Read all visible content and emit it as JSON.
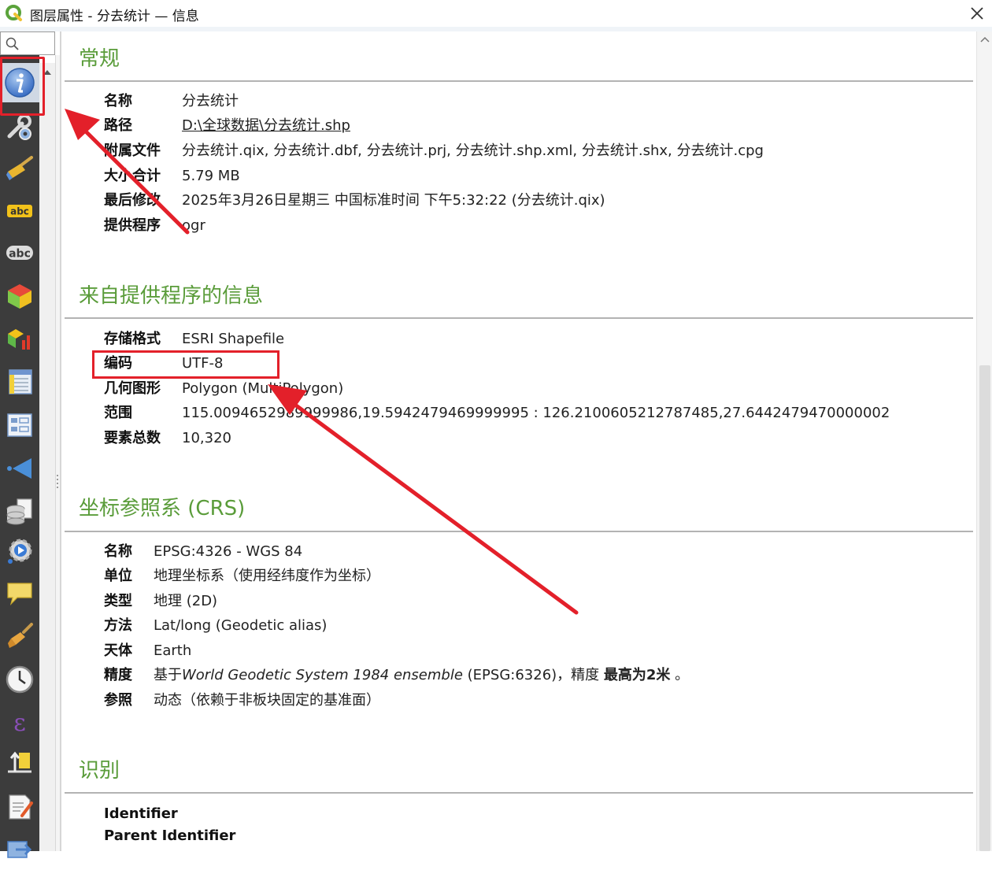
{
  "window": {
    "title": "图层属性 - 分去统计 — 信息",
    "close_icon": "close-icon"
  },
  "sidebar": {
    "search_icon": "search-icon",
    "items": [
      {
        "icon": "info-icon",
        "active": true
      },
      {
        "icon": "source-wrench-icon"
      },
      {
        "icon": "symbology-brush-icon"
      },
      {
        "icon": "labels-abc-icon"
      },
      {
        "icon": "masks-abc-icon"
      },
      {
        "icon": "3d-view-cube-icon"
      },
      {
        "icon": "diagrams-icon"
      },
      {
        "icon": "fields-icon"
      },
      {
        "icon": "attributes-form-icon"
      },
      {
        "icon": "joins-icon"
      },
      {
        "icon": "auxiliary-storage-icon"
      },
      {
        "icon": "actions-icon"
      },
      {
        "icon": "display-tip-icon"
      },
      {
        "icon": "rendering-brush-icon"
      },
      {
        "icon": "temporal-clock-icon"
      },
      {
        "icon": "variables-epsilon-icon"
      },
      {
        "icon": "elevation-icon"
      },
      {
        "icon": "metadata-icon"
      },
      {
        "icon": "dependencies-icon"
      }
    ]
  },
  "general": {
    "title": "常规",
    "rows": [
      {
        "k": "名称",
        "v": "分去统计"
      },
      {
        "k": "路径",
        "v": "D:\\全球数据\\分去统计.shp",
        "link": true
      },
      {
        "k": "附属文件",
        "v": "分去统计.qix, 分去统计.dbf, 分去统计.prj, 分去统计.shp.xml, 分去统计.shx, 分去统计.cpg"
      },
      {
        "k": "大小合计",
        "v": "5.79 MB"
      },
      {
        "k": "最后修改",
        "v": "2025年3月26日星期三 中国标准时间 下午5:32:22 (分去统计.qix)"
      },
      {
        "k": "提供程序",
        "v": "ogr"
      }
    ]
  },
  "provider": {
    "title": "来自提供程序的信息",
    "rows": [
      {
        "k": "存储格式",
        "v": "ESRI Shapefile"
      },
      {
        "k": "编码",
        "v": "UTF-8"
      },
      {
        "k": "几何图形",
        "v": "Polygon (MultiPolygon)"
      },
      {
        "k": "范围",
        "v": "115.0094652989999986,19.5942479469999995 : 126.2100605212787485,27.6442479470000002"
      },
      {
        "k": "要素总数",
        "v": "10,320"
      }
    ]
  },
  "crs": {
    "title": "坐标参照系 (CRS)",
    "rows": [
      {
        "k": "名称",
        "v": "EPSG:4326 - WGS 84"
      },
      {
        "k": "单位",
        "v": "地理坐标系（使用经纬度作为坐标）"
      },
      {
        "k": "类型",
        "v": "地理 (2D)"
      },
      {
        "k": "方法",
        "v": "Lat/long (Geodetic alias)"
      },
      {
        "k": "天体",
        "v": "Earth"
      },
      {
        "k": "精度",
        "v_prefix": "基于",
        "v_italic": "World Geodetic System 1984 ensemble",
        "v_mid": " (EPSG:6326)，精度 ",
        "v_bold": "最高为2米",
        "v_suffix": " 。"
      },
      {
        "k": "参照",
        "v": "动态（依赖于非板块固定的基准面）"
      }
    ]
  },
  "identification": {
    "title": "识别",
    "rows": [
      {
        "k": "Identifier"
      },
      {
        "k": "Parent Identifier"
      }
    ]
  },
  "annotations": {
    "color": "#e3202a"
  },
  "colors": {
    "section_title": "#5a9c3a",
    "link": "#4a7fd6",
    "sidebar_bg": "#3c3c3c"
  }
}
